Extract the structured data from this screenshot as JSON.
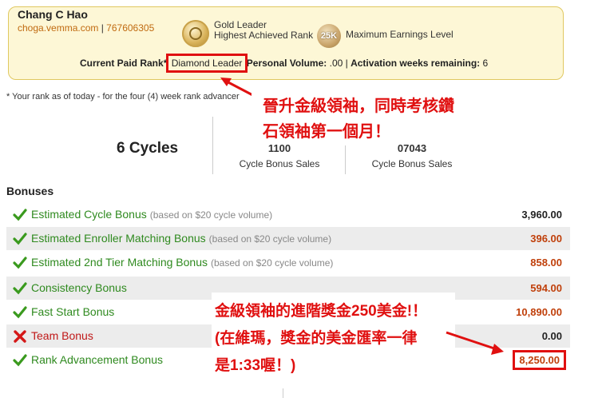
{
  "header": {
    "name": "Chang C Hao",
    "site": "choga.vemma.com",
    "id": "767606305",
    "current_rank_line1": "Gold Leader",
    "current_rank_line2": "Highest Achieved Rank",
    "max_badge": "25K",
    "max_label": "Maximum Earnings Level",
    "paid_rank_label": "Current Paid Rank*",
    "paid_rank_value": "Diamond Leader",
    "pv_label": "Personal Volume:",
    "pv_value": ".00",
    "weeks_label": "Activation weeks remaining:",
    "weeks_value": "6"
  },
  "note": "* Your rank as of today - for the four (4) week rank advancer",
  "cycles": {
    "count_label": "6 Cycles",
    "left_value": "1100",
    "left_label": "Cycle Bonus Sales",
    "right_value": "07043",
    "right_label": "Cycle Bonus Sales"
  },
  "bonuses": {
    "title": "Bonuses",
    "rows": [
      {
        "label": "Estimated Cycle Bonus",
        "sub": "(based on $20 cycle volume)",
        "amount": "3,960.00"
      },
      {
        "label": "Estimated Enroller Matching Bonus",
        "sub": "(based on $20 cycle volume)",
        "amount": "396.00"
      },
      {
        "label": "Estimated 2nd Tier Matching Bonus",
        "sub": "(based on $20 cycle volume)",
        "amount": "858.00"
      },
      {
        "label": "Consistency Bonus",
        "sub": "",
        "amount": "594.00"
      },
      {
        "label": "Fast Start Bonus",
        "sub": "",
        "amount": "10,890.00"
      },
      {
        "label": "Team Bonus",
        "sub": "",
        "amount": "0.00"
      },
      {
        "label": "Rank Advancement Bonus",
        "sub": "",
        "amount": "8,250.00"
      }
    ]
  },
  "annotations": {
    "a1_line1": "晉升金級領袖，同時考核鑽",
    "a1_line2": "石領袖第一個月！",
    "a2_line1": "金級領袖的進階獎金250美金!！",
    "a2_line2": "(在維瑪，獎金的美金匯率一律",
    "a2_line3": "是1:33喔！)"
  },
  "colors": {
    "accent_red": "#e01010",
    "label_green": "#2f8a1f",
    "amount_orange": "#c0400b",
    "card_bg": "#fdf7d6"
  },
  "icons": {
    "check": "check-icon",
    "cross": "cross-icon",
    "medal": "gold-medal-icon"
  }
}
